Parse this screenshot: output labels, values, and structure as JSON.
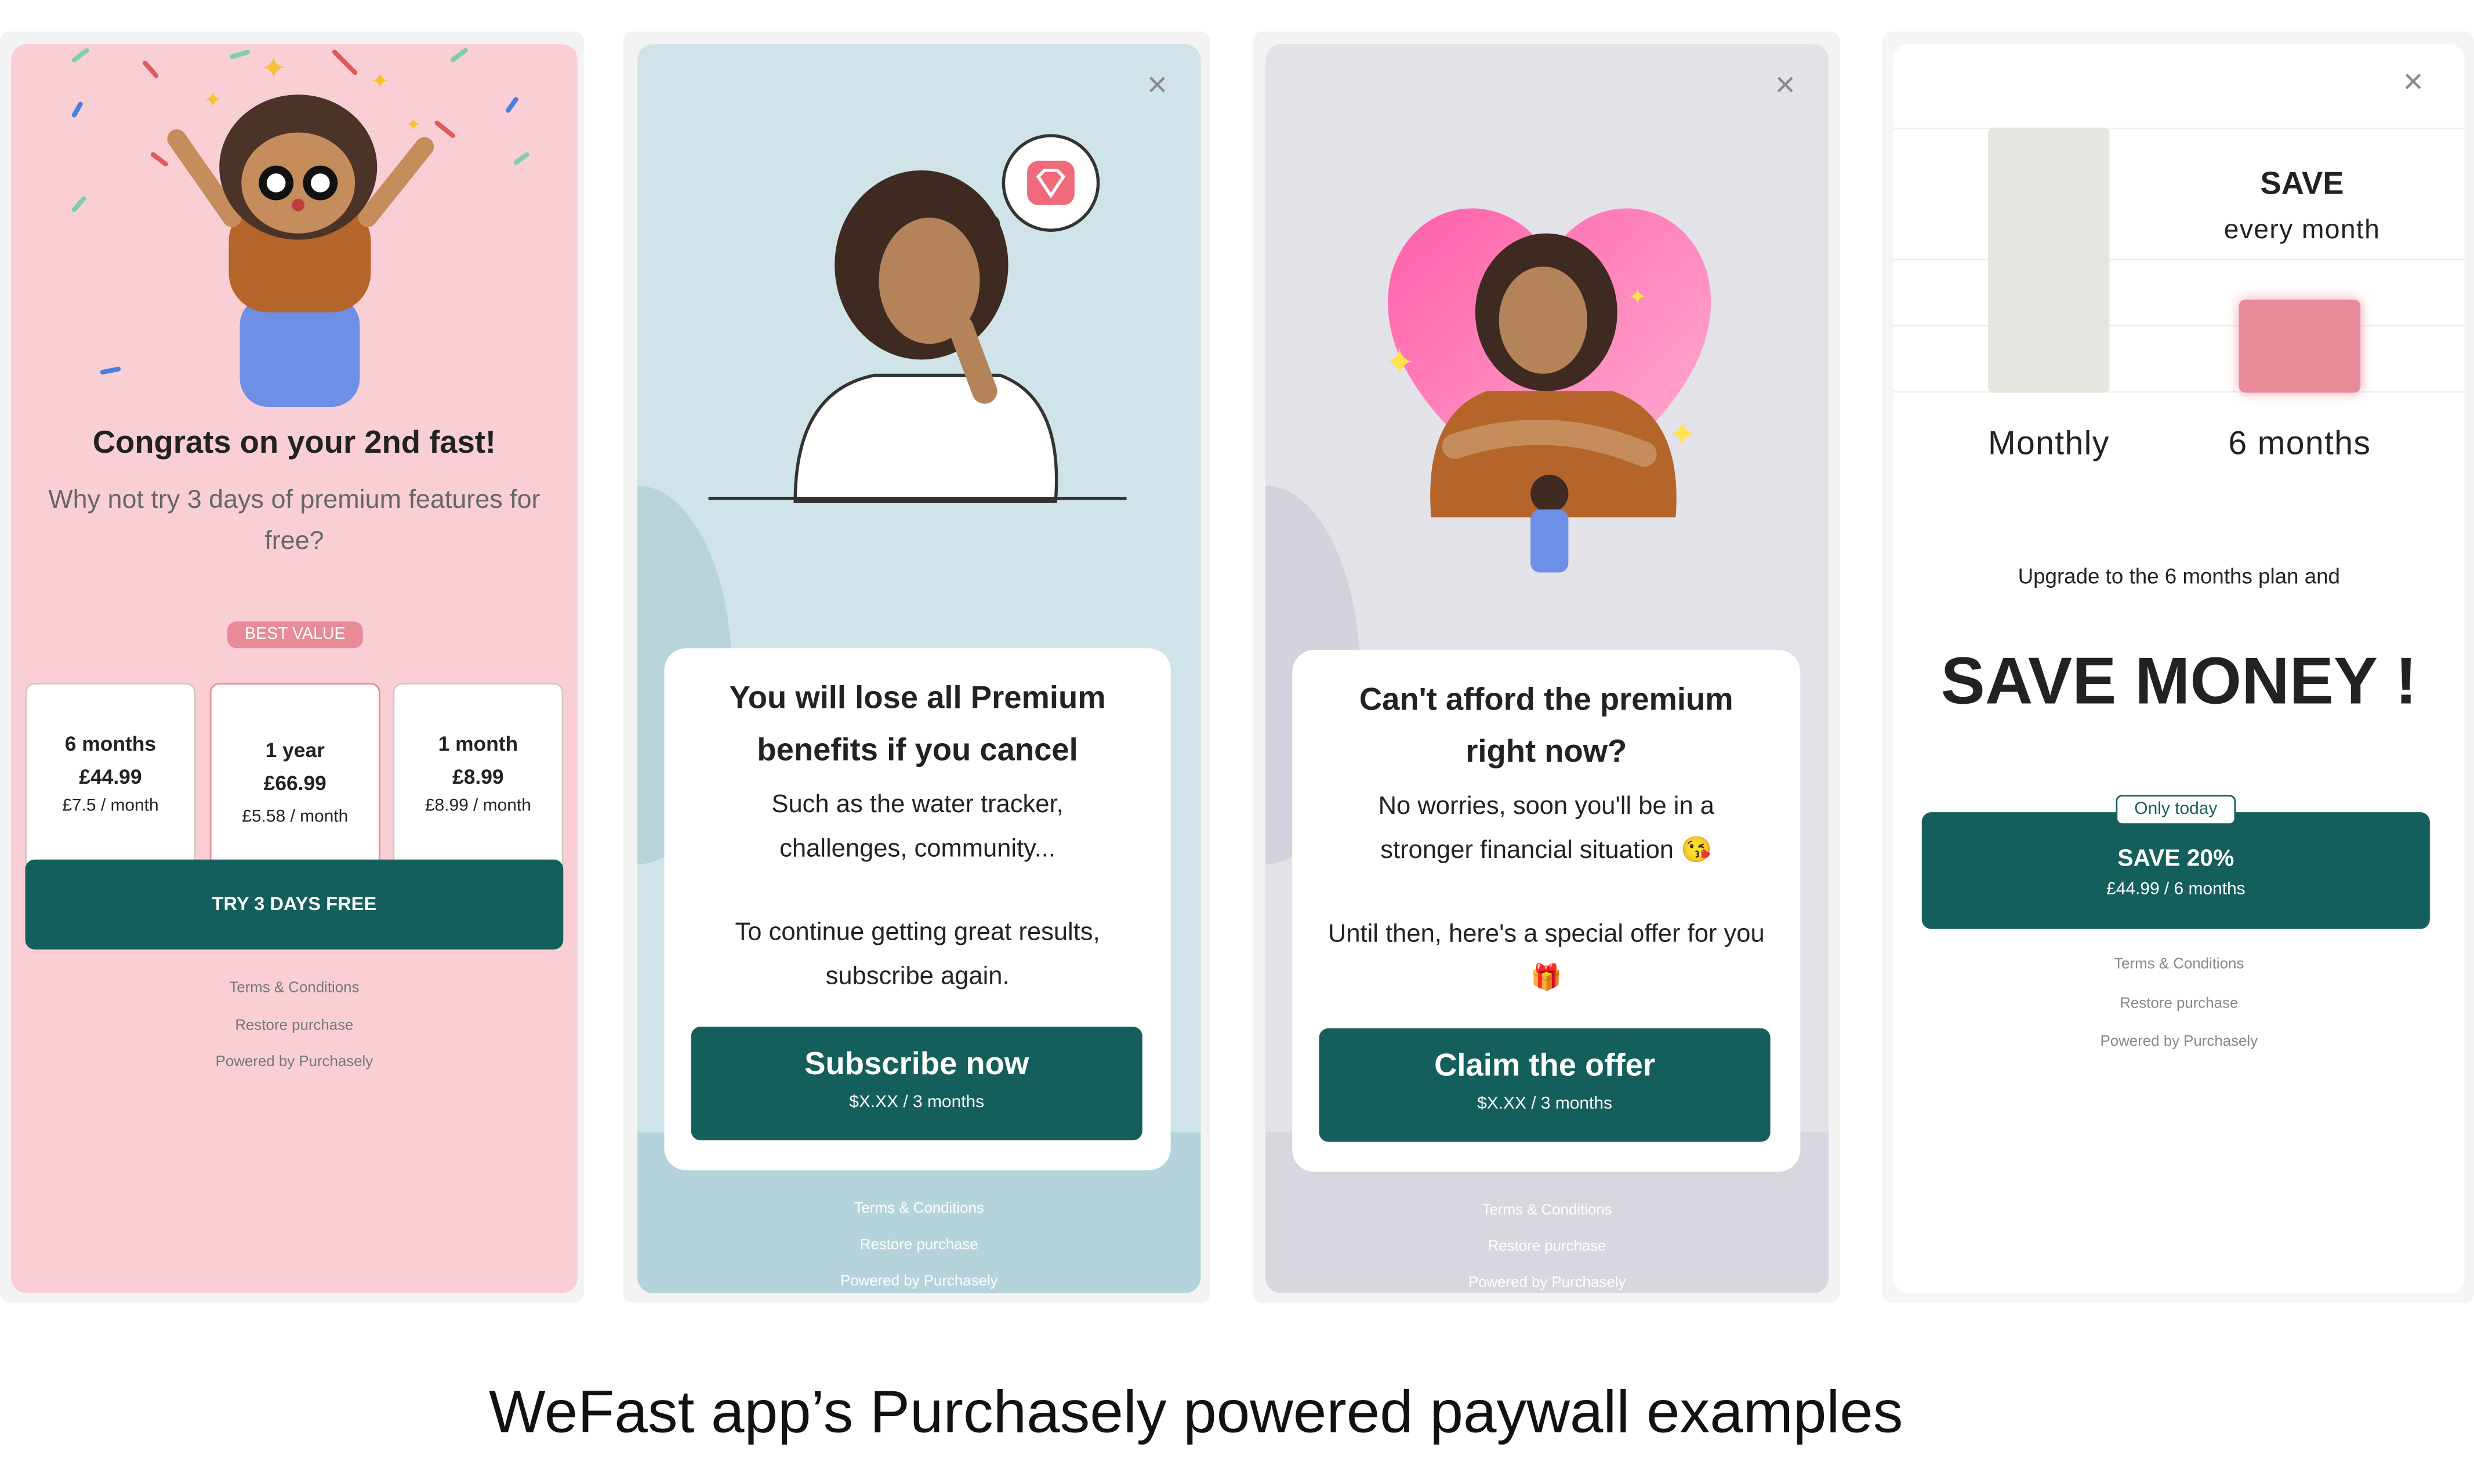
{
  "colors": {
    "brand_green": "#145f5b",
    "pink_bg": "#f9cfd5",
    "blue_bg": "#cfe3e8",
    "gray_bg": "#e3e2e8",
    "accent_pink": "#e88a98"
  },
  "footer_links": {
    "terms": "Terms & Conditions",
    "restore": "Restore purchase",
    "powered": "Powered by Purchasely"
  },
  "paywall1": {
    "title": "Congrats on your 2nd fast!",
    "subtitle": "Why not try 3 days of premium features for free?",
    "badge": "BEST VALUE",
    "plans": [
      {
        "name": "6 months",
        "price": "£44.99",
        "monthly": "£7.5 / month"
      },
      {
        "name": "1 year",
        "price": "£66.99",
        "monthly": "£5.58 / month"
      },
      {
        "name": "1 month",
        "price": "£8.99",
        "monthly": "£8.99 / month"
      }
    ],
    "cta": "TRY 3 DAYS FREE",
    "illustration": "celebrating-woman-confetti"
  },
  "paywall2": {
    "title": "You will lose all Premium benefits if you cancel",
    "body1": "Such as the water tracker, challenges, community...",
    "body2": "To continue getting great results, subscribe again.",
    "cta": "Subscribe now",
    "cta_sub": "$X.XX / 3 months",
    "close_icon": "×",
    "illustration": "thinking-woman-diamond"
  },
  "paywall3": {
    "title": "Can't afford the premium right now?",
    "body1": "No worries, soon you'll be in a stronger financial situation 😘",
    "body2": "Until then, here's a special offer for you 🎁",
    "cta": "Claim the offer",
    "cta_sub": "$X.XX / 3 months",
    "close_icon": "×",
    "illustration": "self-hug-heart"
  },
  "paywall4": {
    "close_icon": "×",
    "save_label": "SAVE",
    "save_sub": "every month",
    "bar_labels": [
      "Monthly",
      "6 months"
    ],
    "intro": "Upgrade to the 6 months plan and",
    "headline": "SAVE MONEY !",
    "badge": "Only today",
    "cta": "SAVE 20%",
    "cta_sub": "£44.99 / 6 months"
  },
  "caption": "WeFast app’s Purchasely powered paywall examples"
}
